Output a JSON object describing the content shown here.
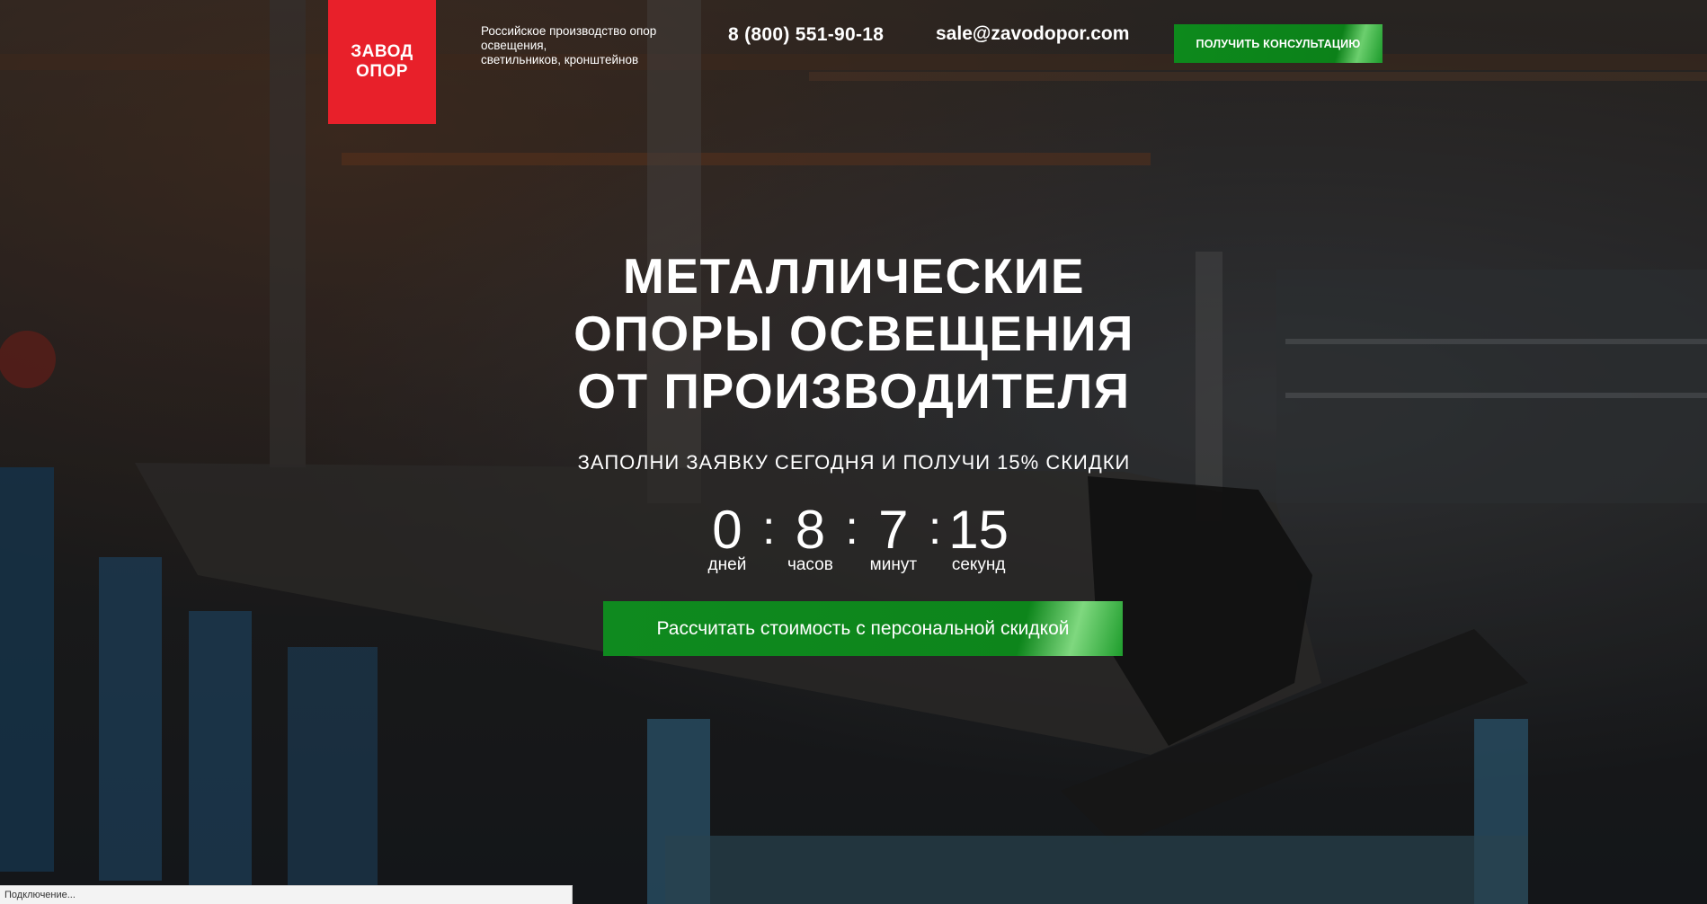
{
  "header": {
    "logo_line1": "ЗАВОД",
    "logo_line2": "ОПОР",
    "tagline_line1": "Российское производство опор",
    "tagline_line2": "освещения,",
    "tagline_line3": "светильников, кронштейнов",
    "phone": "8 (800) 551-90-18",
    "email": "sale@zavodopor.com",
    "consult_button": "ПОЛУЧИТЬ КОНСУЛЬТАЦИЮ"
  },
  "hero": {
    "title_line1": "МЕТАЛЛИЧЕСКИЕ",
    "title_line2": "ОПОРЫ ОСВЕЩЕНИЯ",
    "title_line3": "ОТ ПРОИЗВОДИТЕЛЯ",
    "subtitle": "ЗАПОЛНИ ЗАЯВКУ СЕГОДНЯ И ПОЛУЧИ 15% СКИДКИ",
    "cta_button": "Рассчитать стоимость с персональной скидкой"
  },
  "timer": {
    "days": "0",
    "days_label": "дней",
    "hours": "8",
    "hours_label": "часов",
    "minutes": "7",
    "minutes_label": "минут",
    "seconds": "15",
    "seconds_label": "секунд",
    "separator": ":"
  },
  "status_bar": {
    "text": "Подключение..."
  },
  "colors": {
    "logo_bg": "#e8202a",
    "button_green": "#0d851b"
  }
}
